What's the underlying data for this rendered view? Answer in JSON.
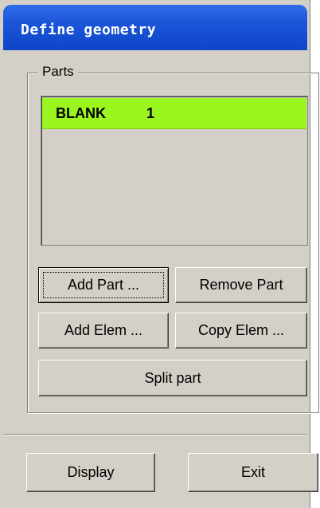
{
  "window": {
    "title": "Define geometry"
  },
  "parts_group": {
    "legend": "Parts",
    "list": [
      {
        "name": "BLANK",
        "id": "1",
        "selected": true
      }
    ],
    "selected_color": "#9bf51f"
  },
  "buttons": {
    "add_part": "Add Part ...",
    "remove_part": "Remove Part",
    "add_elem": "Add Elem ...",
    "copy_elem": "Copy Elem ...",
    "split_part": "Split part",
    "display": "Display",
    "exit": "Exit"
  },
  "colors": {
    "titlebar": "#1b55d8",
    "panel": "#d4d0c8"
  }
}
